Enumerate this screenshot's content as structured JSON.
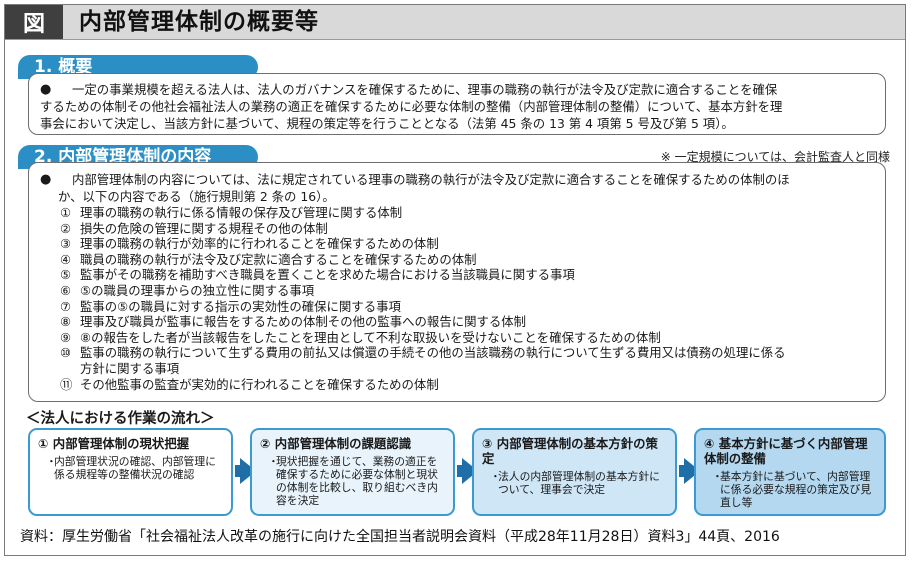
{
  "header": {
    "badge": "図",
    "title": "内部管理体制の概要等"
  },
  "section1": {
    "label": "1. 概要",
    "bullet": "●",
    "text_line1": "一定の事業規模を超える法人は、法人のガバナンスを確保するために、理事の職務の執行が法令及び定款に適合することを確保",
    "text_line2": "するための体制その他社会福祉法人の業務の適正を確保するために必要な体制の整備（内部管理体制の整備）について、基本方針を理",
    "text_line3": "事会において決定し、当該方針に基づいて、規程の策定等を行うこととなる（法第 45 条の 13 第 4 項第 5 号及び第 5 項）。"
  },
  "section2": {
    "label": "2. 内部管理体制の内容",
    "note": "※ 一定規模については、会計監査人と同様",
    "bullet": "●",
    "intro_line1": "内部管理体制の内容については、法に規定されている理事の職務の執行が法令及び定款に適合することを確保するための体制のほ",
    "intro_line2": "か、以下の内容である（施行規則第 2 条の 16）。",
    "items": [
      {
        "num": "①",
        "text": "理事の職務の執行に係る情報の保存及び管理に関する体制"
      },
      {
        "num": "②",
        "text": "損失の危険の管理に関する規程その他の体制"
      },
      {
        "num": "③",
        "text": "理事の職務の執行が効率的に行われることを確保するための体制"
      },
      {
        "num": "④",
        "text": "職員の職務の執行が法令及び定款に適合することを確保するための体制"
      },
      {
        "num": "⑤",
        "text": "監事がその職務を補助すべき職員を置くことを求めた場合における当該職員に関する事項"
      },
      {
        "num": "⑥",
        "text": "⑤の職員の理事からの独立性に関する事項"
      },
      {
        "num": "⑦",
        "text": "監事の⑤の職員に対する指示の実効性の確保に関する事項"
      },
      {
        "num": "⑧",
        "text": "理事及び職員が監事に報告をするための体制その他の監事への報告に関する体制"
      },
      {
        "num": "⑨",
        "text": "⑧の報告をした者が当該報告をしたことを理由として不利な取扱いを受けないことを確保するための体制"
      },
      {
        "num": "⑩",
        "text": "監事の職務の執行について生ずる費用の前払又は償還の手続その他の当該職務の執行について生ずる費用又は債務の処理に係る"
      },
      {
        "num": "",
        "text": "方針に関する事項"
      },
      {
        "num": "⑪",
        "text": "その他監事の監査が実効的に行われることを確保するための体制"
      }
    ]
  },
  "flow": {
    "title": "＜法人における作業の流れ＞",
    "steps": [
      {
        "title": "① 内部管理体制の現状把握",
        "bullet": "・",
        "body": "内部管理状況の確認、内部管理に係る規程等の整備状況の確認",
        "bg": "#ffffff"
      },
      {
        "title": "② 内部管理体制の課題認識",
        "bullet": "・",
        "body": "現状把握を通じて、業務の適正を確保するために必要な体制と現状の体制を比較し、取り組むべき内容を決定",
        "bg": "#e8f3fb"
      },
      {
        "title": "③ 内部管理体制の基本方針の策定",
        "bullet": "・",
        "body": "法人の内部管理体制の基本方針について、理事会で決定",
        "bg": "#cfe6f6"
      },
      {
        "title": "④ 基本方針に基づく内部管理体制の整備",
        "bullet": "・",
        "body": "基本方針に基づいて、内部管理に係る必要な規程の策定及び見直し等",
        "bg": "#b3d8f0"
      }
    ]
  },
  "source": "資料：厚生労働省「社会福祉法人改革の施行に向けた全国担当者説明会資料（平成28年11月28日）資料3」44頁、2016",
  "colors": {
    "accent": "#2b8fc6",
    "arrow": "#1f6ea8",
    "step_border": "#3a9ad1"
  }
}
